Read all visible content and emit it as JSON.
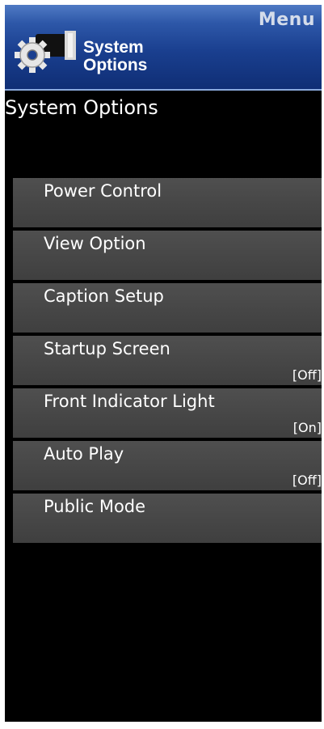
{
  "header": {
    "menu_label": "Menu",
    "title_line1": "System",
    "title_line2": "Options",
    "icon": "gear-icon"
  },
  "section_title": "System Options",
  "menu_items": [
    {
      "label": "Power Control",
      "value": ""
    },
    {
      "label": "View Option",
      "value": ""
    },
    {
      "label": "Caption Setup",
      "value": ""
    },
    {
      "label": "Startup Screen",
      "value": "[Off]"
    },
    {
      "label": "Front Indicator Light",
      "value": "[On]"
    },
    {
      "label": "Auto Play",
      "value": "[Off]"
    },
    {
      "label": "Public Mode",
      "value": ""
    }
  ],
  "colors": {
    "header_blue": "#1a3f8f",
    "item_gray": "#474747",
    "background": "#000000",
    "text": "#ffffff"
  }
}
